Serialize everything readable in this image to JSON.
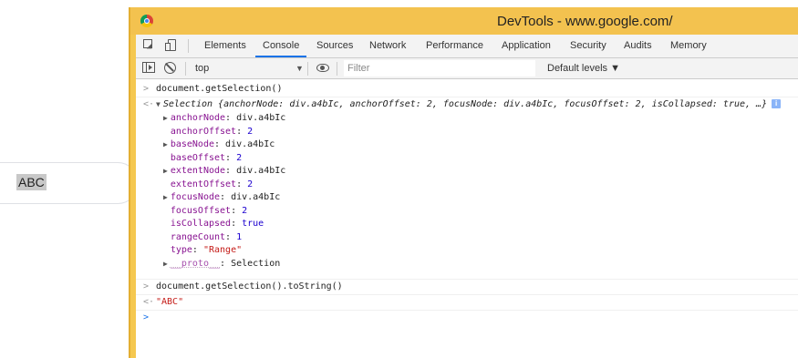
{
  "page": {
    "search_text": "ABC"
  },
  "window": {
    "title": "DevTools - www.google.com/"
  },
  "tabs": [
    "Elements",
    "Console",
    "Sources",
    "Network",
    "Performance",
    "Application",
    "Security",
    "Audits",
    "Memory"
  ],
  "active_tab": "Console",
  "toolbar": {
    "context": "top",
    "filter_placeholder": "Filter",
    "levels": "Default levels ▼"
  },
  "console": {
    "input1": "document.getSelection()",
    "summary_type": "Selection",
    "summary_text": "{anchorNode: div.a4bIc, anchorOffset: 2, focusNode: div.a4bIc, focusOffset: 2, isCollapsed: true, …}",
    "info_glyph": "i",
    "props": [
      {
        "expandable": true,
        "key": "anchorNode",
        "value": "div.a4bIc",
        "kind": "obj"
      },
      {
        "expandable": false,
        "key": "anchorOffset",
        "value": "2",
        "kind": "num"
      },
      {
        "expandable": true,
        "key": "baseNode",
        "value": "div.a4bIc",
        "kind": "obj"
      },
      {
        "expandable": false,
        "key": "baseOffset",
        "value": "2",
        "kind": "num"
      },
      {
        "expandable": true,
        "key": "extentNode",
        "value": "div.a4bIc",
        "kind": "obj"
      },
      {
        "expandable": false,
        "key": "extentOffset",
        "value": "2",
        "kind": "num"
      },
      {
        "expandable": true,
        "key": "focusNode",
        "value": "div.a4bIc",
        "kind": "obj"
      },
      {
        "expandable": false,
        "key": "focusOffset",
        "value": "2",
        "kind": "num"
      },
      {
        "expandable": false,
        "key": "isCollapsed",
        "value": "true",
        "kind": "bool"
      },
      {
        "expandable": false,
        "key": "rangeCount",
        "value": "1",
        "kind": "num"
      },
      {
        "expandable": false,
        "key": "type",
        "value": "\"Range\"",
        "kind": "str"
      },
      {
        "expandable": true,
        "key": "__proto__",
        "value": "Selection",
        "kind": "obj"
      }
    ],
    "input2": "document.getSelection().toString()",
    "output2": "\"ABC\"",
    "input_glyph": ">",
    "output_glyph": "<·",
    "prompt_glyph": ">"
  },
  "colors": {
    "window_frame": "#f5c850",
    "active_tab_underline": "#1a73e8",
    "property_key": "#881391",
    "number": "#1c00cf",
    "string": "#c41a16"
  }
}
